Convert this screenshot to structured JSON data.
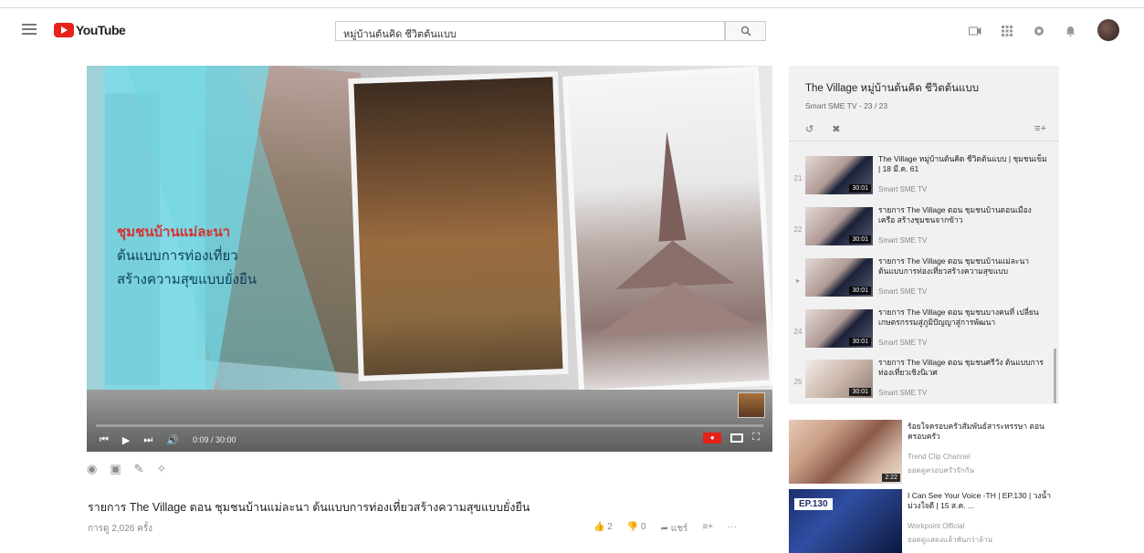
{
  "header": {
    "logo_text": "YouTube",
    "search_value": "หมู่บ้านต้นคิด ชีวิตต้นแบบ"
  },
  "player": {
    "overlay_line1": "ชุมชนบ้านแม่ละนา",
    "overlay_line2": "ต้นแบบการท่องเที่ยว",
    "overlay_line3": "สร้างความสุขแบบยั่งยืน",
    "time": "0:09 / 30:00"
  },
  "video": {
    "title": "รายการ The Village ตอน ชุมชนบ้านแม่ละนา ต้นแบบการท่องเที่ยวสร้างความสุขแบบยั่งยืน",
    "views": "การดู 2,026 ครั้ง",
    "likes": "2",
    "dislikes": "0",
    "share": "แชร์"
  },
  "playlist": {
    "title": "The Village หมู่บ้านต้นคิด ชีวิตต้นแบบ",
    "subtitle": "Smart SME TV - 23 / 23",
    "items": [
      {
        "index": "21",
        "title": "The Village หมู่บ้านต้นคิด ชีวิตต้นแบบ | ชุมชนเข็ม | 18 มี.ค. 61",
        "channel": "Smart SME TV",
        "duration": "30:01"
      },
      {
        "index": "22",
        "title": "รายการ The Village ตอน ชุมชนบ้านดอนเมือง เครือ สร้างชุมชนจากข้าว",
        "channel": "Smart SME TV",
        "duration": "30:01"
      },
      {
        "index": "▸",
        "title": "รายการ The Village ตอน ชุมชนบ้านแม่ละนา ต้นแบบการท่องเที่ยวสร้างความสุขแบบ",
        "channel": "Smart SME TV",
        "duration": "30:01"
      },
      {
        "index": "24",
        "title": "รายการ The Village ตอน ชุมชนบางคนที่ เปลี่ยน เกษตรกรรมสู่ภูมิปัญญาสู่การพัฒนา",
        "channel": "Smart SME TV",
        "duration": "30:01"
      },
      {
        "index": "25",
        "title": "รายการ The Village ตอน ชุมชนศรีวัง ต้นแบบการท่องเที่ยวเชิงนิเวศ",
        "channel": "Smart SME TV",
        "duration": "30:01"
      }
    ]
  },
  "recommendations": [
    {
      "title": "ร้อยใจครอบครัวสัมพันธ์สาระหรรษา ตอนครอบครัว",
      "channel": "Trend Clip Channel",
      "views": "ยอดดูครอบครัวรักกัน",
      "duration": "2:22"
    },
    {
      "title": "I Can See Your Voice -TH | EP.130 | วงน้ำ ม่วงใจดี | 15 ส.ค. ...",
      "channel": "Workpoint Official",
      "views": "ยอดดูแสดงแล้วพันกว่าล้าน",
      "badge": "EP.130"
    }
  ]
}
